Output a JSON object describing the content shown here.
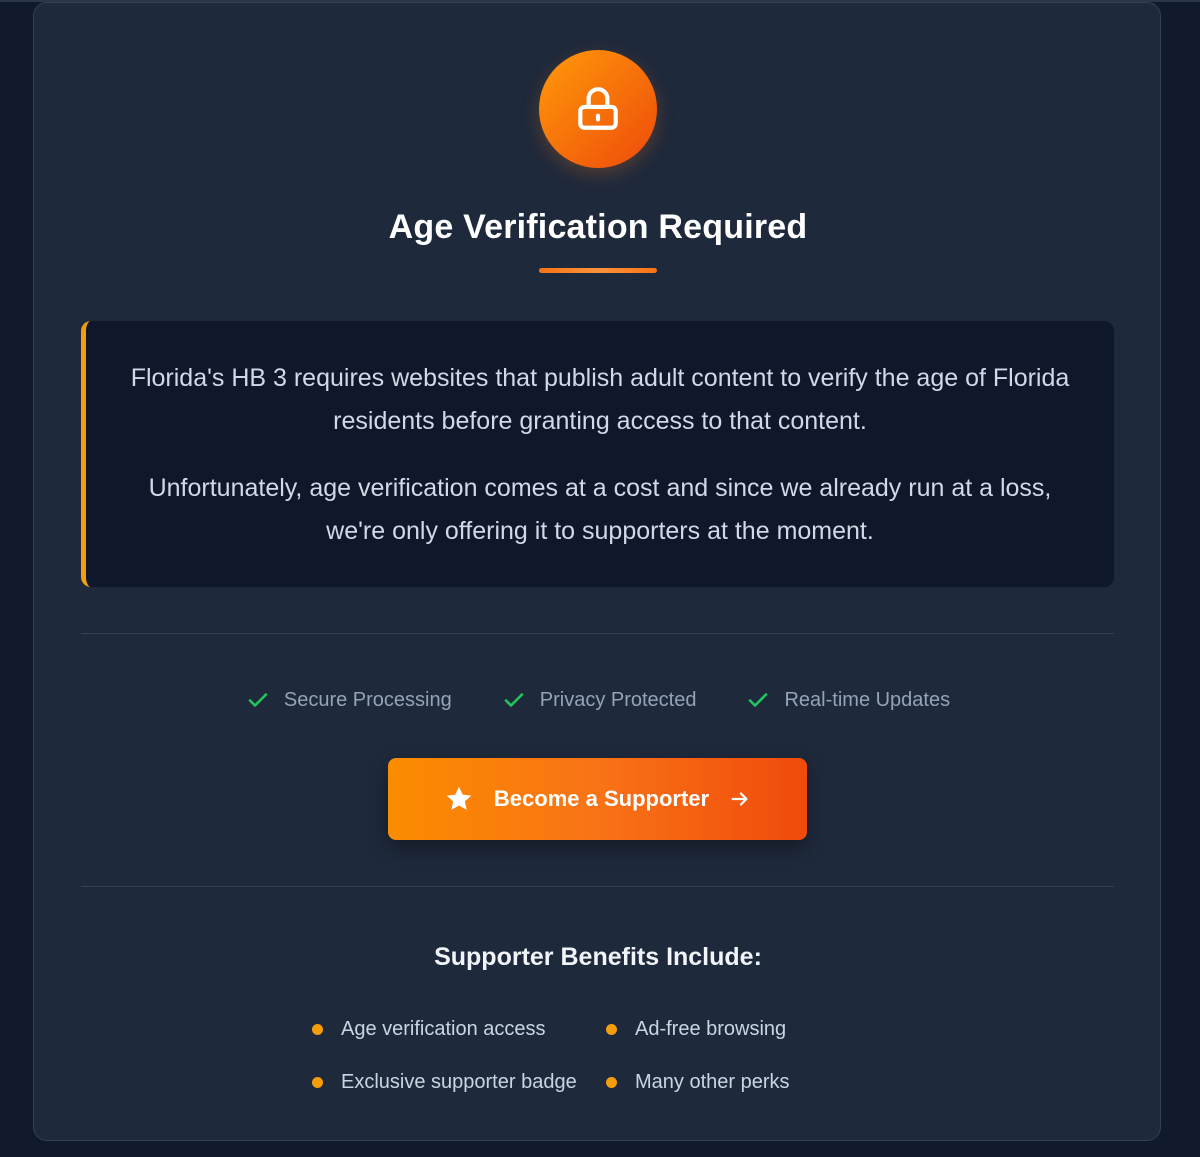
{
  "modal": {
    "title": "Age Verification Required",
    "icon": "lock-icon"
  },
  "notice": {
    "paragraph1": "Florida's HB 3 requires websites that publish adult content to verify the age of Florida residents before granting access to that content.",
    "paragraph2": "Unfortunately, age verification comes at a cost and since we already run at a loss, we're only offering it to supporters at the moment."
  },
  "features": [
    {
      "label": "Secure Processing",
      "icon": "check-icon"
    },
    {
      "label": "Privacy Protected",
      "icon": "check-icon"
    },
    {
      "label": "Real-time Updates",
      "icon": "check-icon"
    }
  ],
  "cta": {
    "label": "Become a Supporter",
    "leading_icon": "star-icon",
    "trailing_icon": "arrow-right-icon"
  },
  "benefits": {
    "title": "Supporter Benefits Include:",
    "items": [
      "Age verification access",
      "Ad-free browsing",
      "Exclusive supporter badge",
      "Many other perks"
    ]
  },
  "colors": {
    "accent": "#f97316",
    "accent_amber": "#f59e0b",
    "check_green": "#22c55e",
    "card_bg": "#1e293b",
    "notice_bg": "#0f172a"
  }
}
